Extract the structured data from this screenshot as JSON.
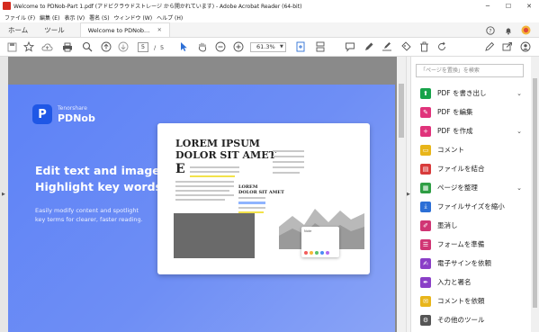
{
  "window": {
    "title": "Welcome to PDNob-Part 1.pdf (アドビクラウドストレージ から開かれています) - Adobe Acrobat Reader (64-bit)",
    "minimize": "─",
    "maximize": "☐",
    "close": "✕"
  },
  "menu": [
    "ファイル (F)",
    "編集 (E)",
    "表示 (V)",
    "署名 (S)",
    "ウィンドウ (W)",
    "ヘルプ (H)"
  ],
  "tabs": {
    "home": "ホーム",
    "tools": "ツール",
    "document": "Welcome to PDNob...",
    "document_close": "✕"
  },
  "toolbar": {
    "current_page": "5",
    "separator": "/",
    "total_pages": "5",
    "zoom": "61.3%"
  },
  "document": {
    "brand_small": "Tenorshare",
    "brand_name": "PDNob",
    "logo_letter": "P",
    "hero_line1": "Edit text and image",
    "hero_line2": "Highlight key words",
    "sub_line1": "Easily modify content and spotlight",
    "sub_line2": "key terms for clearer, faster reading.",
    "mock_heading1": "LOREM IPSUM",
    "mock_heading2": "DOLOR SIT AMET",
    "mock_bigE": "E",
    "mock_rhead1": "LOREM",
    "mock_rhead2": "DOLOR SIT AMET",
    "sidecard_text": "Note"
  },
  "right_panel": {
    "search_placeholder": "「ページを置換」を検索",
    "tools": [
      {
        "label": "PDF を書き出し",
        "icon": "export-pdf-icon",
        "color": "#17a34a",
        "expand": true
      },
      {
        "label": "PDF を編集",
        "icon": "edit-pdf-icon",
        "color": "#e0337b",
        "expand": false
      },
      {
        "label": "PDF を作成",
        "icon": "create-pdf-icon",
        "color": "#e0337b",
        "expand": true
      },
      {
        "label": "コメント",
        "icon": "comment-icon",
        "color": "#e8b51a",
        "expand": false
      },
      {
        "label": "ファイルを結合",
        "icon": "combine-files-icon",
        "color": "#d83b3b",
        "expand": false
      },
      {
        "label": "ページを整理",
        "icon": "organize-pages-icon",
        "color": "#2f9e44",
        "expand": true
      },
      {
        "label": "ファイルサイズを縮小",
        "icon": "compress-icon",
        "color": "#2c6fd6",
        "expand": false
      },
      {
        "label": "墨消し",
        "icon": "redact-icon",
        "color": "#d03574",
        "expand": false
      },
      {
        "label": "フォームを準備",
        "icon": "prepare-form-icon",
        "color": "#d03574",
        "expand": false
      },
      {
        "label": "電子サインを依頼",
        "icon": "request-esign-icon",
        "color": "#8a3fc7",
        "expand": false
      },
      {
        "label": "入力と署名",
        "icon": "fill-sign-icon",
        "color": "#8a3fc7",
        "expand": false
      },
      {
        "label": "コメントを依頼",
        "icon": "request-comments-icon",
        "color": "#e8b51a",
        "expand": false
      },
      {
        "label": "その他のツール",
        "icon": "more-tools-icon",
        "color": "#555555",
        "expand": false
      }
    ]
  }
}
